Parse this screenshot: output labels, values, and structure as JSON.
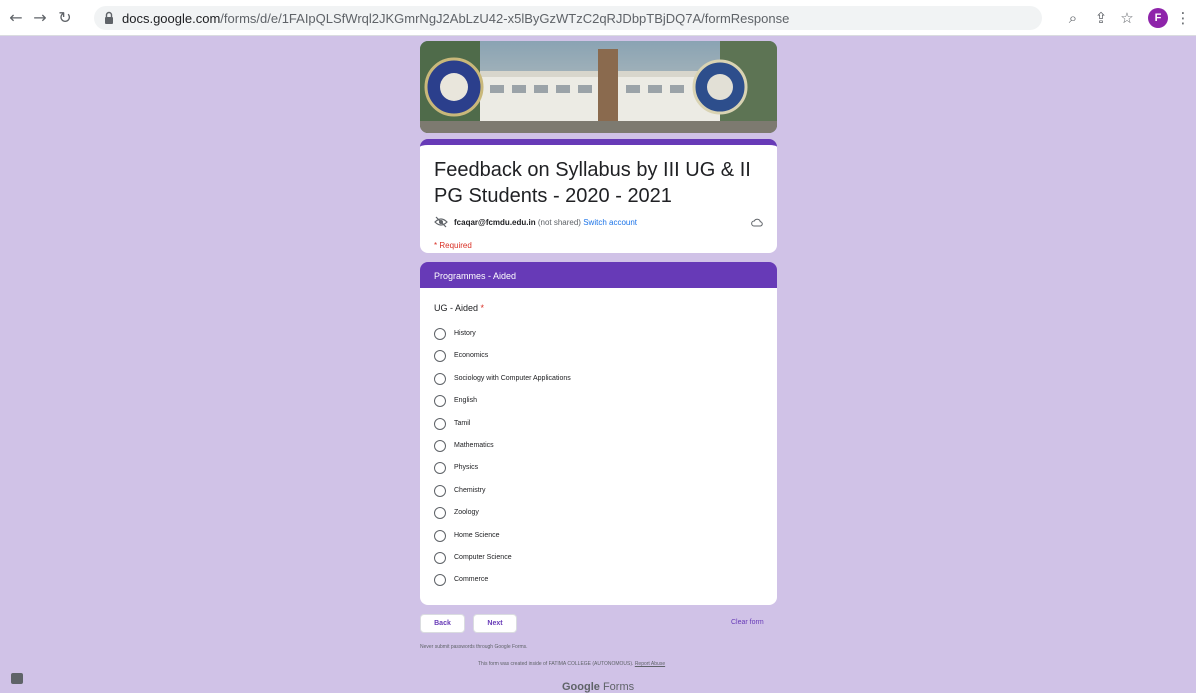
{
  "browser": {
    "url_host": "docs.google.com",
    "url_path": "/forms/d/e/1FAIpQLSfWrql2JKGmrNgJ2AbLzU42-x5lByGzWTzC2qRJDbpTBjDQ7A/formResponse",
    "avatar_letter": "F",
    "accent": "#8e24aa"
  },
  "form": {
    "title": "Feedback on Syllabus by III UG & II PG Students - 2020 - 2021",
    "account_email": "fcaqar@fcmdu.edu.in",
    "not_shared": "(not shared)",
    "switch_account": "Switch account",
    "required_note": "* Required",
    "theme_color": "#673ab7"
  },
  "section": {
    "title": "Programmes - Aided"
  },
  "question": {
    "title": "UG - Aided",
    "required_mark": "*",
    "options": [
      "History",
      "Economics",
      "Sociology with Computer Applications",
      "English",
      "Tamil",
      "Mathematics",
      "Physics",
      "Chemistry",
      "Zoology",
      "Home Science",
      "Computer Science",
      "Commerce"
    ]
  },
  "footer": {
    "back_label": "Back",
    "next_label": "Next",
    "clear_label": "Clear form",
    "password_note": "Never submit passwords through Google Forms.",
    "created_text": "This form was created inside of FATIMA COLLEGE (AUTONOMOUS).",
    "report_abuse": "Report Abuse",
    "brand_google": "Google",
    "brand_forms": "Forms"
  }
}
